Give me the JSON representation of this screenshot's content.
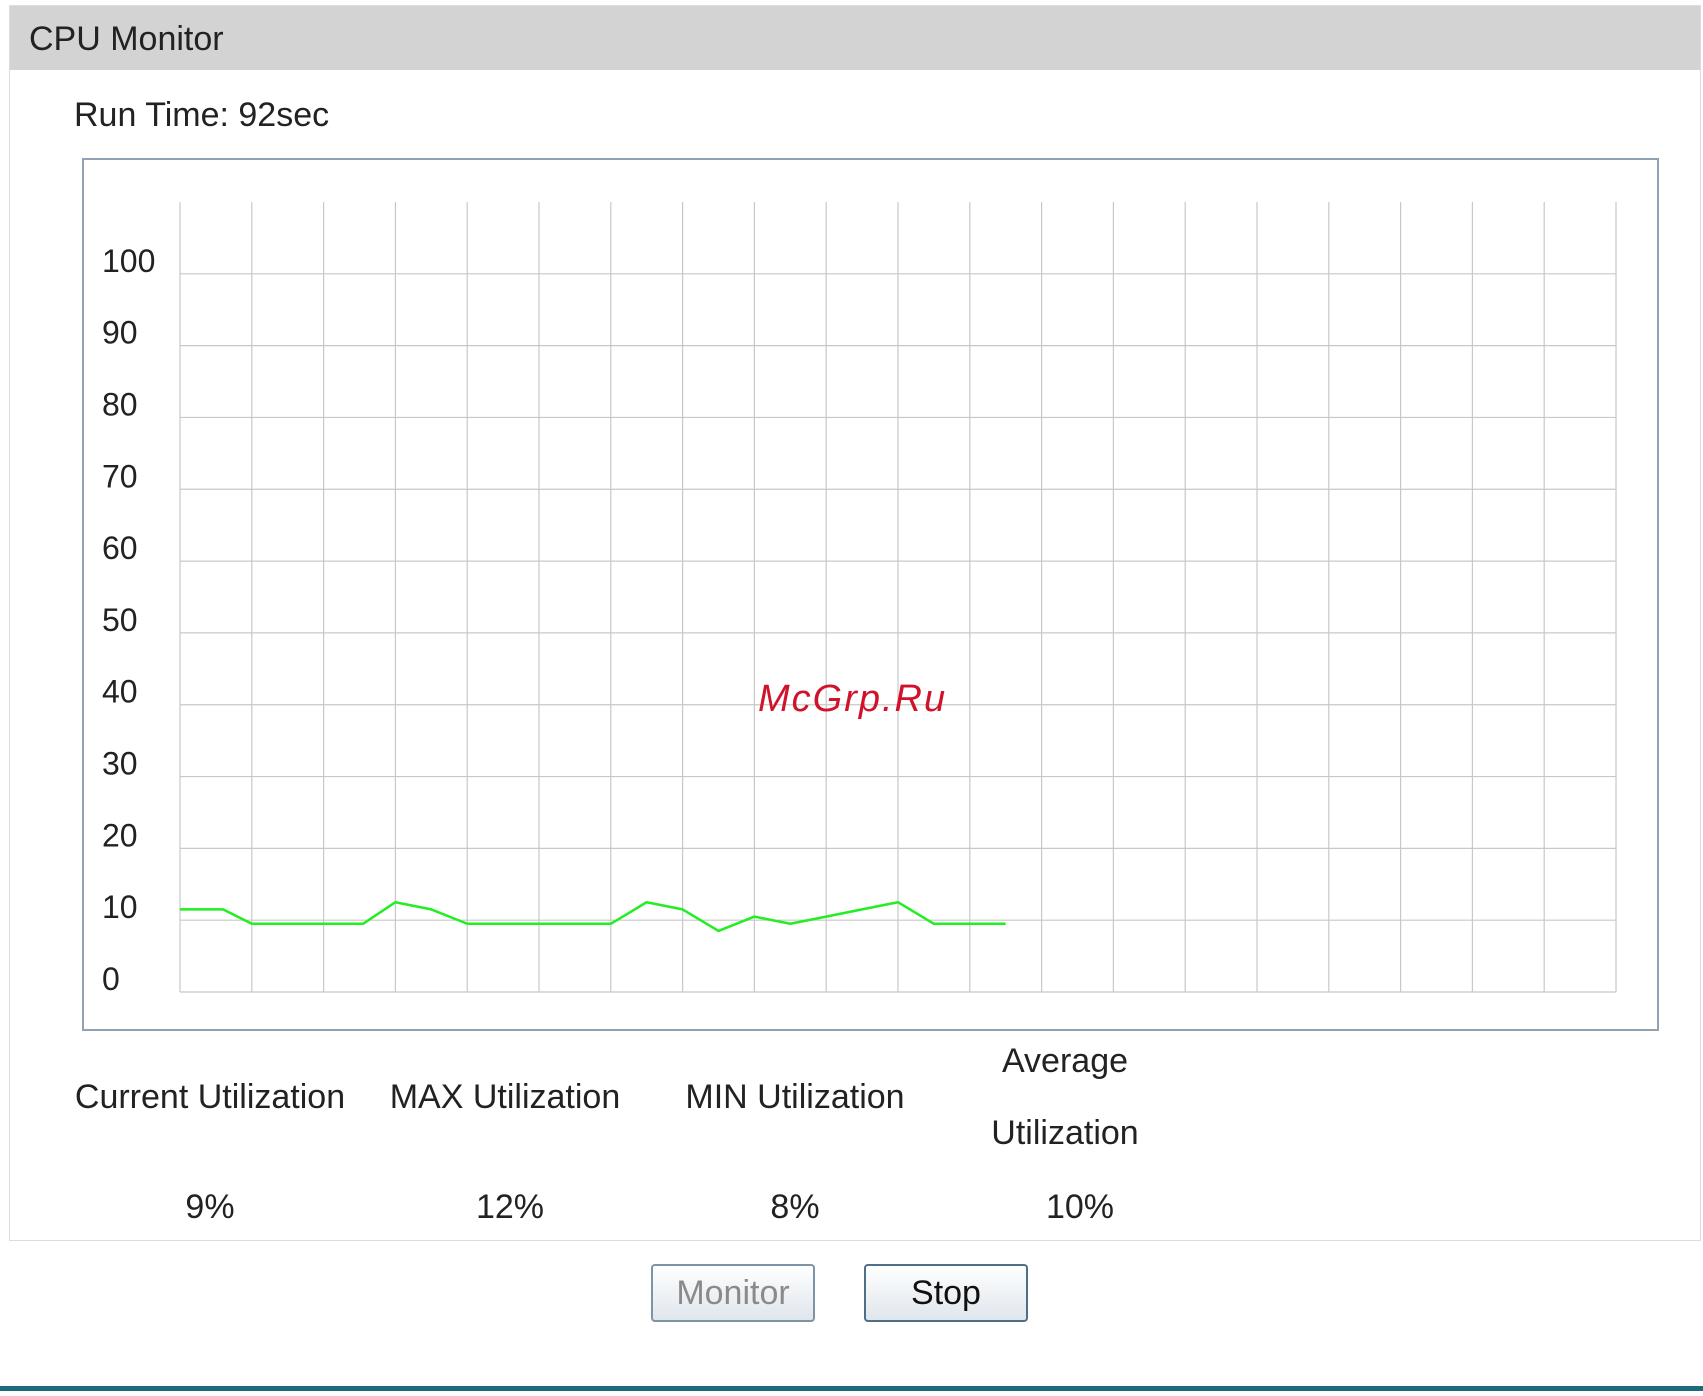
{
  "panel": {
    "title": "CPU Monitor"
  },
  "run_time": "Run Time: 92sec",
  "watermark": "McGrp.Ru",
  "chart_data": {
    "type": "line",
    "title": "",
    "xlabel": "",
    "ylabel": "",
    "ylim": [
      0,
      110
    ],
    "y_ticks": [
      0,
      10,
      20,
      30,
      40,
      50,
      60,
      70,
      80,
      90,
      100
    ],
    "x_range": [
      0,
      40
    ],
    "grid": true,
    "line_color": "#22ee22",
    "series": [
      {
        "x": [
          0,
          1.2,
          2,
          3,
          4,
          5.1,
          6,
          7,
          8,
          9,
          10,
          11.2,
          12,
          13,
          14,
          15,
          16,
          17,
          18,
          19,
          20,
          21,
          22,
          23
        ],
        "values": [
          11.5,
          11.5,
          9.5,
          9.5,
          9.5,
          9.5,
          12.5,
          11.5,
          9.5,
          9.5,
          9.5,
          9.5,
          9.5,
          12.5,
          11.5,
          8.5,
          10.5,
          9.5,
          10.5,
          11.5,
          12.5,
          9.5,
          9.5,
          9.5
        ]
      }
    ]
  },
  "stats": {
    "current_label": "Current Utilization",
    "max_label": "MAX Utilization",
    "min_label": "MIN Utilization",
    "avg_label_line1": "Average",
    "avg_label_line2": "Utilization",
    "current_value": "9%",
    "max_value": "12%",
    "min_value": "8%",
    "avg_value": "10%"
  },
  "buttons": {
    "monitor": "Monitor",
    "stop": "Stop"
  },
  "colors": {
    "header_bg": "#d3d3d3",
    "line": "#22ee22",
    "footer_line": "#1f6b7d"
  }
}
